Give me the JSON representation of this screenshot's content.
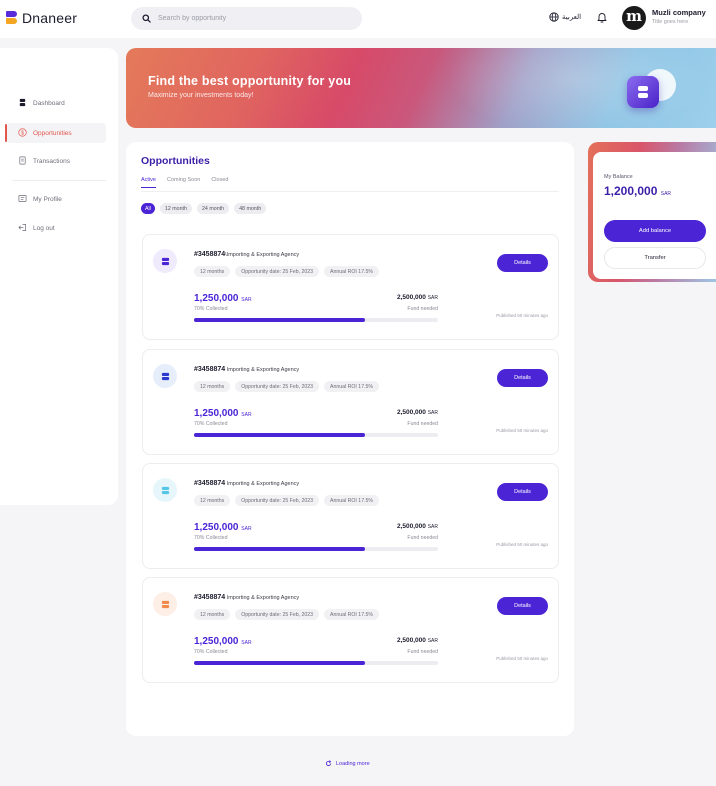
{
  "app": {
    "name": "Dnaneer",
    "brand_colors": {
      "primary": "#4b24d6",
      "accent_orange": "#f5a623",
      "active_nav": "#e2574c"
    }
  },
  "header": {
    "search_placeholder": "Search by opportunity",
    "language_label": "العربية",
    "avatar_letter": "m",
    "company_name": "Muzli company",
    "company_subtitle": "Title goes here"
  },
  "sidebar": {
    "items": [
      {
        "label": "Dashboard",
        "icon": "dashboard-icon",
        "active": false
      },
      {
        "label": "Opportunities",
        "icon": "dollar-circle-icon",
        "active": true
      },
      {
        "label": "Transactions",
        "icon": "document-icon",
        "active": false
      },
      {
        "label": "My Profile",
        "icon": "profile-card-icon",
        "active": false
      },
      {
        "label": "Log out",
        "icon": "logout-icon",
        "active": false
      }
    ]
  },
  "banner": {
    "title": "Find the best opportunity for you",
    "subtitle": "Maximize your investments today!"
  },
  "opportunities": {
    "title": "Opportunities",
    "tabs": [
      {
        "label": "Active",
        "active": true
      },
      {
        "label": "Coming Soon",
        "active": false
      },
      {
        "label": "Closed",
        "active": false
      }
    ],
    "filters": [
      {
        "label": "All",
        "active": true
      },
      {
        "label": "12 month",
        "active": false
      },
      {
        "label": "24 month",
        "active": false
      },
      {
        "label": "48 month",
        "active": false
      }
    ],
    "cards": [
      {
        "id": "#3458874",
        "agency": "\\Importing & Exporting Agency",
        "icon_color": "purple",
        "tags": [
          "12 months",
          "Opportunity date: 25 Feb, 2023",
          "Annual ROI 17.5%"
        ],
        "details_label": "Details",
        "amount": "1,250,000",
        "amount_currency": "SAR",
        "collected_label": "70% Collected",
        "collected_fraction": 0.7,
        "fund_amount": "2,500,000",
        "fund_currency": "SAR",
        "fund_label": "Fund needed",
        "published": "Published 50 minutes ago"
      },
      {
        "id": "#3458874",
        "agency": " Importing & Exporting Agency",
        "icon_color": "blue",
        "tags": [
          "12 months",
          "Opportunity date: 25 Feb, 2023",
          "Annual ROI 17.5%"
        ],
        "details_label": "Details",
        "amount": "1,250,000",
        "amount_currency": "SAR",
        "collected_label": "70% Collected",
        "collected_fraction": 0.7,
        "fund_amount": "2,500,000",
        "fund_currency": "SAR",
        "fund_label": "Fund needed",
        "published": "Published 50 minutes ago"
      },
      {
        "id": "#3458874",
        "agency": " Importing & Exporting Agency",
        "icon_color": "cyan",
        "tags": [
          "12 months",
          "Opportunity date: 25 Feb, 2023",
          "Annual ROI 17.5%"
        ],
        "details_label": "Details",
        "amount": "1,250,000",
        "amount_currency": "SAR",
        "collected_label": "70% Collected",
        "collected_fraction": 0.7,
        "fund_amount": "2,500,000",
        "fund_currency": "SAR",
        "fund_label": "Fund needed",
        "published": "Published 50 minutes ago"
      },
      {
        "id": "#3458874",
        "agency": " Importing & Exporting Agency",
        "icon_color": "orange",
        "tags": [
          "12 months",
          "Opportunity date: 25 Feb, 2023",
          "Annual ROI 17.5%"
        ],
        "details_label": "Details",
        "amount": "1,250,000",
        "amount_currency": "SAR",
        "collected_label": "70% Collected",
        "collected_fraction": 0.7,
        "fund_amount": "2,500,000",
        "fund_currency": "SAR",
        "fund_label": "Fund needed",
        "published": "Published 50 minutes ago"
      }
    ],
    "loading_label": "Loading more"
  },
  "balance": {
    "label": "My Balance",
    "amount": "1,200,000",
    "currency": "SAR",
    "add_label": "Add balance",
    "transfer_label": "Transfer"
  }
}
